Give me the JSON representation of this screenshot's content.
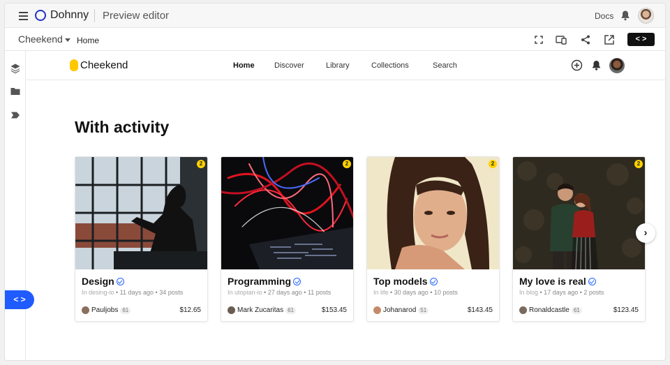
{
  "app": {
    "brand": "Dohnny",
    "title": "Preview editor",
    "docs_label": "Docs",
    "icons": {
      "menu": "hamburger-icon",
      "notifications": "bell-icon"
    }
  },
  "toolbar": {
    "project": "Cheekend",
    "page": "Home",
    "code_label": "< >",
    "icons": [
      "fullscreen-icon",
      "responsive-icon",
      "share-icon",
      "open-external-icon"
    ]
  },
  "rail": {
    "icons": [
      "layers-icon",
      "folder-icon",
      "tag-icon"
    ],
    "code_label": "< >"
  },
  "site": {
    "brand": "Cheekend",
    "nav": [
      {
        "label": "Home",
        "active": true
      },
      {
        "label": "Discover",
        "active": false
      },
      {
        "label": "Library",
        "active": false
      },
      {
        "label": "Collections",
        "active": false
      },
      {
        "label": "Search",
        "active": false
      }
    ],
    "section_title": "With activity",
    "cards": [
      {
        "title": "Design",
        "badge": "2",
        "meta_in": "In desing-io",
        "meta_rest": " • 11 days ago • 34 posts",
        "author": "Pauljobs",
        "author_count": "61",
        "price": "$12.65"
      },
      {
        "title": "Programming",
        "badge": "2",
        "meta_in": "In utopian-io",
        "meta_rest": " • 27 days ago • 11 posts",
        "author": "Mark Zucaritas",
        "author_count": "61",
        "price": "$153.45"
      },
      {
        "title": "Top models",
        "badge": "2",
        "meta_in": "In life",
        "meta_rest": " • 30 days ago • 10 posts",
        "author": "Johanarod",
        "author_count": "51",
        "price": "$143.45"
      },
      {
        "title": "My love is real",
        "badge": "2",
        "meta_in": "In blog",
        "meta_rest": " • 17 days ago • 2 posts",
        "author": "Ronaldcastle",
        "author_count": "61",
        "price": "$123.45"
      }
    ],
    "next_label": "›"
  },
  "colors": {
    "accent": "#1f5bff",
    "badge": "#ffd200",
    "brand_ring": "#2333c2"
  }
}
